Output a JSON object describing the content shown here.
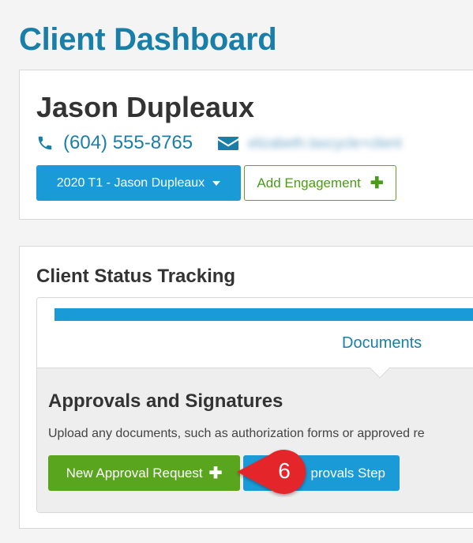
{
  "page": {
    "title": "Client Dashboard"
  },
  "client": {
    "name": "Jason Dupleaux",
    "phone": "(604) 555-8765",
    "email": "elizabeth.taxcycle+client",
    "engagement_button": "2020 T1 - Jason Dupleaux",
    "add_engagement_button": "Add Engagement",
    "icons": {
      "phone": "phone-icon",
      "email": "envelope-icon",
      "caret": "caret-down-icon",
      "add": "plus-icon"
    }
  },
  "tracking": {
    "title": "Client Status Tracking",
    "tab_label": "Documents",
    "section_title": "Approvals and Signatures",
    "section_description": "Upload any documents, such as authorization forms or approved re",
    "new_approval_button": "New Approval Request",
    "approvals_step_button": "provals Step",
    "progress_fraction": 1.0
  },
  "annotation": {
    "callout_number": "6",
    "color": "#e4262a"
  },
  "colors": {
    "brand_blue": "#1a7fa8",
    "button_blue": "#1a9bd7",
    "button_green": "#5aa51e",
    "background": "#f4f4f4"
  }
}
